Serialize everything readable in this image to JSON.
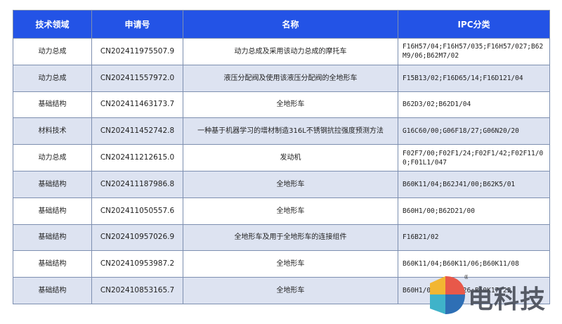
{
  "table": {
    "headers": [
      "技术领域",
      "申请号",
      "名称",
      "IPC分类"
    ],
    "rows": [
      [
        "动力总成",
        "CN202411975507.9",
        "动力总成及采用该动力总成的摩托车",
        "F16H57/04;F16H57/035;F16H57/027;B62M9/06;B62M7/02"
      ],
      [
        "动力总成",
        "CN202411557972.0",
        "液压分配阀及使用该液压分配阀的全地形车",
        "F15B13/02;F16D65/14;F16D121/04"
      ],
      [
        "基础结构",
        "CN202411463173.7",
        "全地形车",
        "B62D3/02;B62D1/04"
      ],
      [
        "材料技术",
        "CN202411452742.8",
        "一种基于机器学习的增材制造316L不锈钢抗拉强度预测方法",
        "G16C60/00;G06F18/27;G06N20/20"
      ],
      [
        "动力总成",
        "CN202411212615.0",
        "发动机",
        "F02F7/00;F02F1/24;F02F1/42;F02F11/00;F01L1/047"
      ],
      [
        "基础结构",
        "CN202411187986.8",
        "全地形车",
        "B60K11/04;B62J41/00;B62K5/01"
      ],
      [
        "基础结构",
        "CN202411050557.6",
        "全地形车",
        "B60H1/00;B62D21/00"
      ],
      [
        "基础结构",
        "CN202410957026.9",
        "全地形车及用于全地形车的连接组件",
        "F16B21/02"
      ],
      [
        "基础结构",
        "CN202410953987.2",
        "全地形车",
        "B60K11/04;B60K11/06;B60K11/08"
      ],
      [
        "基础结构",
        "CN202410853165.7",
        "全地形车",
        "B60H1/00;B60H1/26;B60K17/22"
      ]
    ]
  },
  "logo": {
    "text": "电科技",
    "registered_mark": "®",
    "colors": [
      "#f2b632",
      "#e8584a",
      "#3fb3c9",
      "#2e6fb5"
    ]
  }
}
